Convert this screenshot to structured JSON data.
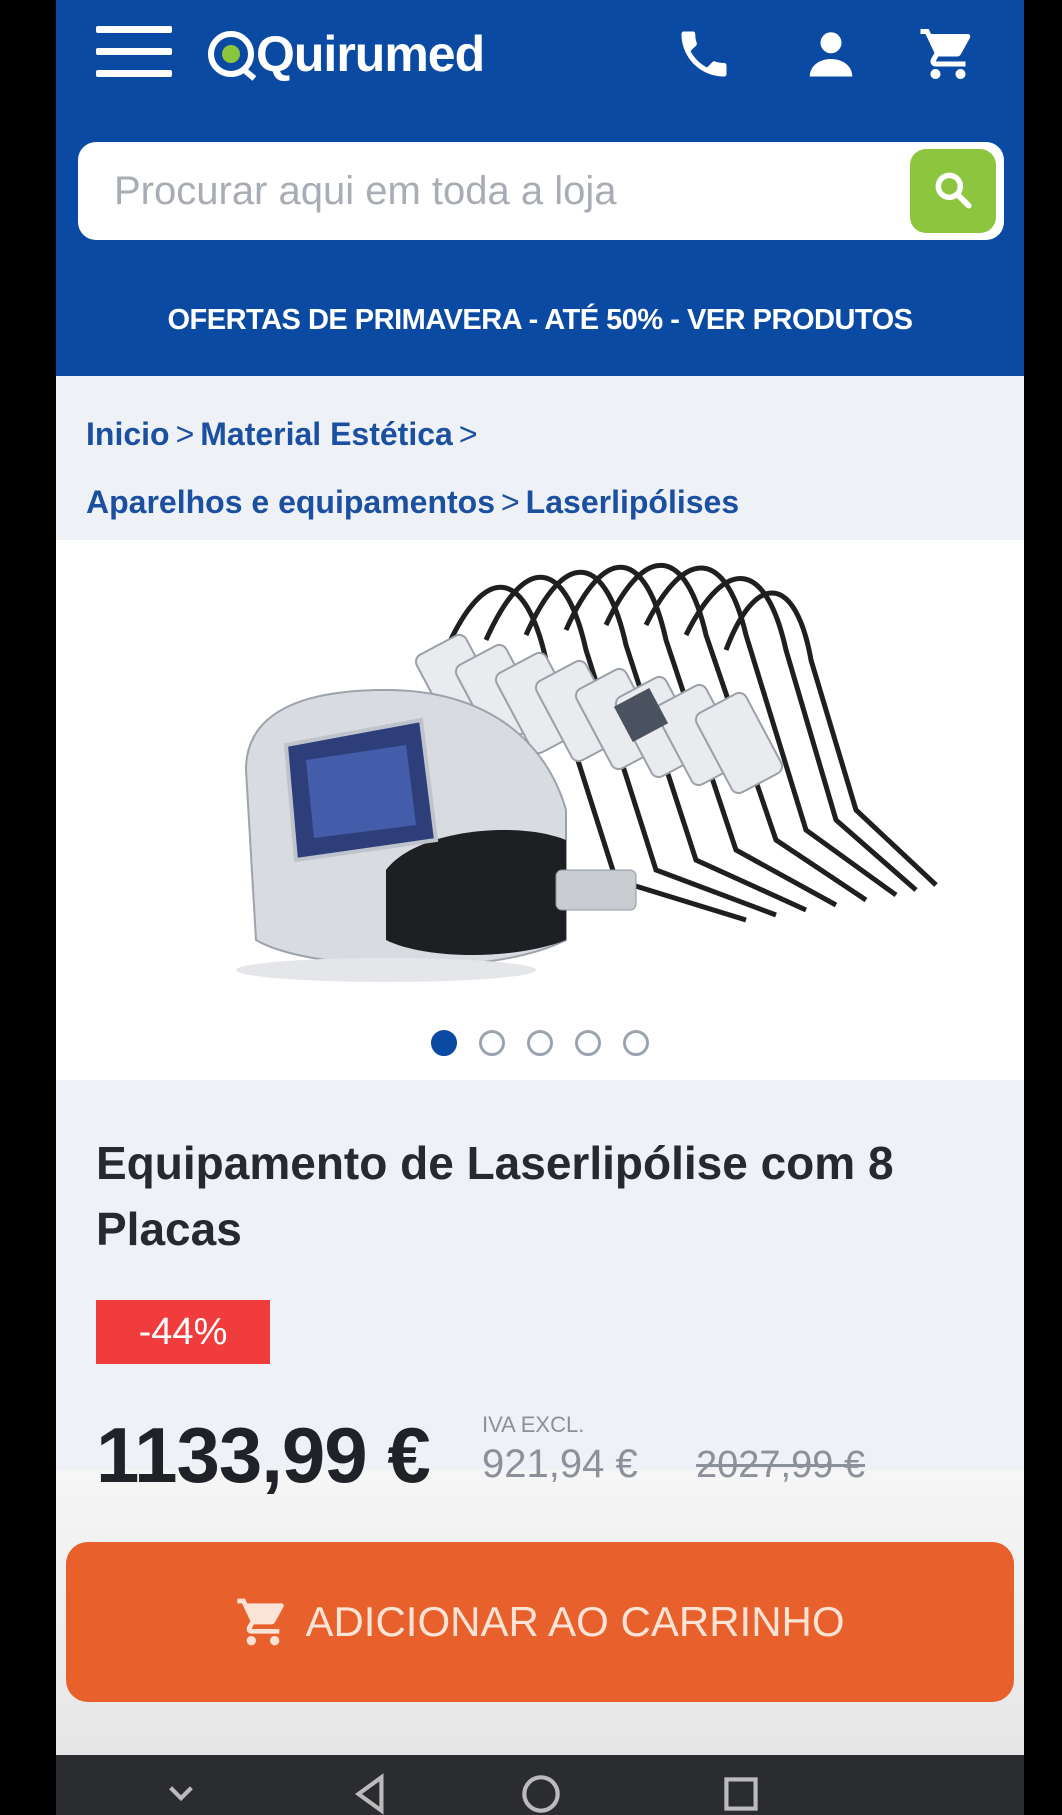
{
  "header": {
    "logo_text": "Quirumed",
    "search": {
      "placeholder": "Procurar aqui em toda a loja"
    },
    "promo_banner": "OFERTAS DE PRIMAVERA - ATÉ 50% - VER PRODUTOS"
  },
  "breadcrumb": {
    "items": [
      "Inicio",
      "Material Estética",
      "Aparelhos e equipamentos",
      "Laserlipólises"
    ],
    "separator": ">"
  },
  "gallery": {
    "image_count": 5,
    "active_index": 0
  },
  "product": {
    "title": "Equipamento de Laserlipólise com 8 Placas",
    "discount": "-44%",
    "price": "1133,99 €",
    "iva_label": "IVA EXCL.",
    "price_ex_vat": "921,94 €",
    "old_price": "2027,99 €"
  },
  "cart": {
    "add_label": "ADICIONAR AO CARRINHO"
  },
  "colors": {
    "brand_blue": "#0b4aa2",
    "search_green": "#8cc63f",
    "discount_red": "#f03c3c",
    "cart_orange": "#e8612c"
  },
  "icons": [
    "menu-icon",
    "phone-icon",
    "account-icon",
    "cart-icon",
    "search-icon",
    "back-icon",
    "home-icon",
    "recents-icon",
    "keyboard-hide-icon"
  ]
}
